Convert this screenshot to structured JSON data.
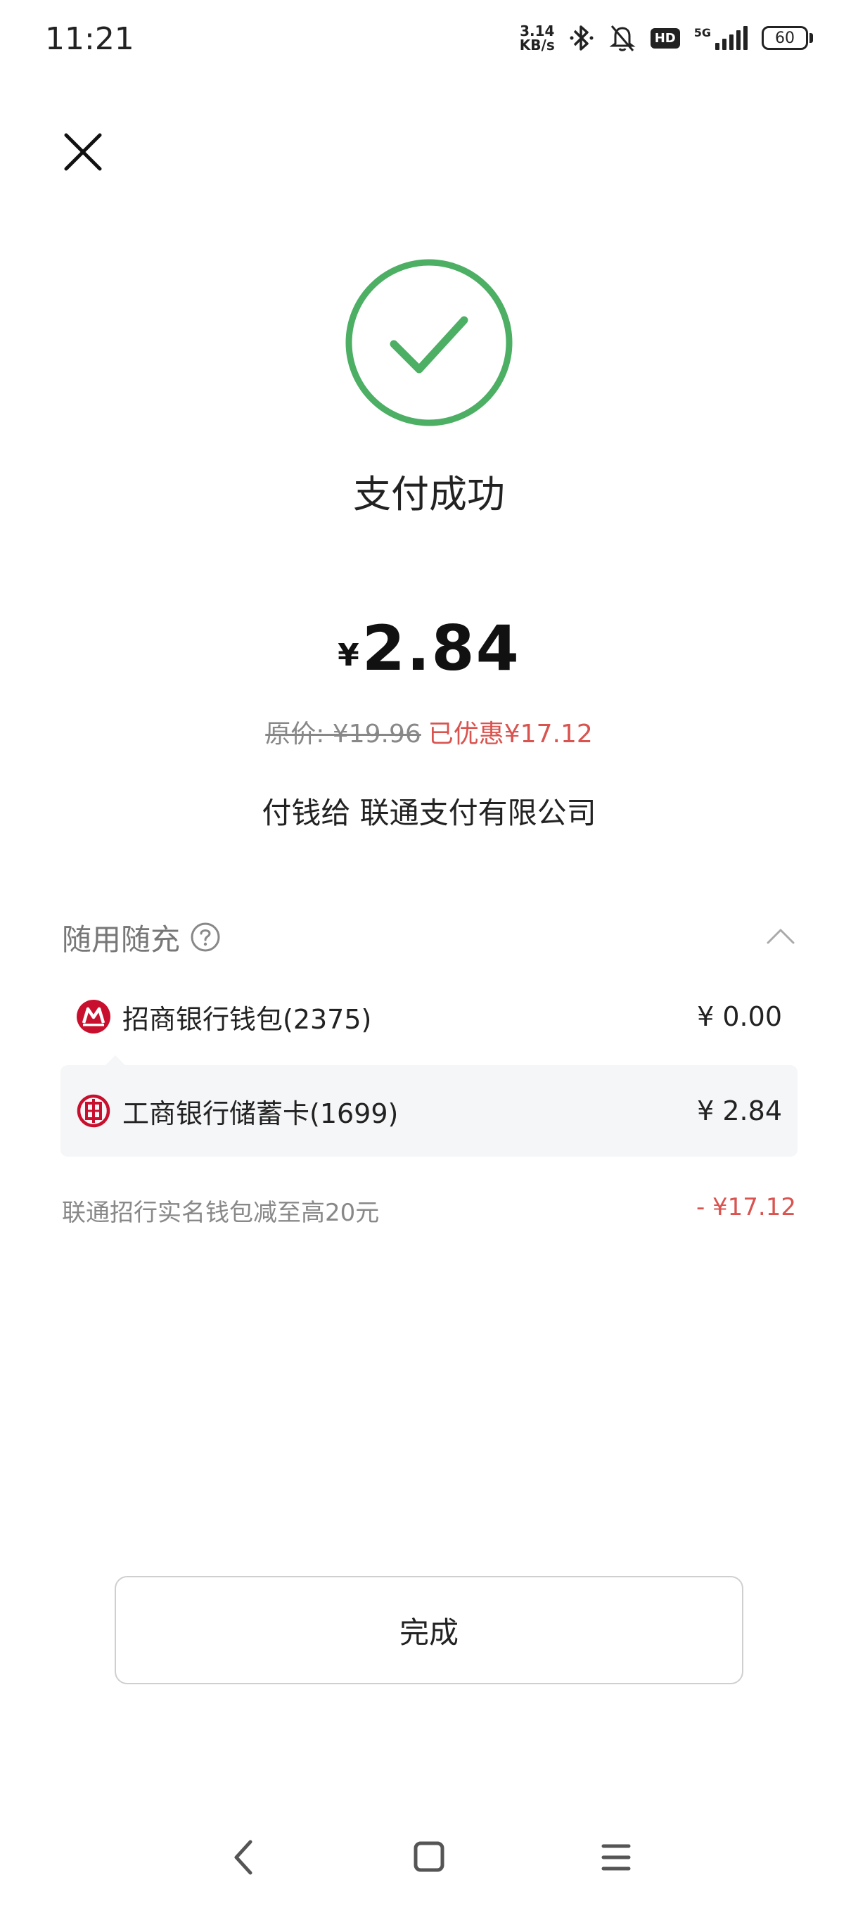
{
  "status_bar": {
    "time": "11:21",
    "net_speed_value": "3.14",
    "net_speed_unit": "KB/s",
    "hd_label": "HD",
    "network_type": "5G",
    "battery": "60"
  },
  "success": {
    "title": "支付成功"
  },
  "amount": {
    "currency": "¥",
    "value": "2.84"
  },
  "price_line": {
    "original": "原价: ¥19.96",
    "saved": "已优惠¥17.12"
  },
  "payee": "付钱给 联通支付有限公司",
  "payment_section": {
    "title": "随用随充",
    "methods": [
      {
        "name": "招商银行钱包(2375)",
        "amount": "¥ 0.00"
      },
      {
        "name": "工商银行储蓄卡(1699)",
        "amount": "¥ 2.84"
      }
    ]
  },
  "discount": {
    "label": "联通招行实名钱包减至高20元",
    "value": "- ¥17.12"
  },
  "done_label": "完成",
  "colors": {
    "success_green": "#4caf64",
    "discount_red": "#d9534f",
    "cmb_red": "#c8102e",
    "icbc_red": "#c8102e"
  }
}
